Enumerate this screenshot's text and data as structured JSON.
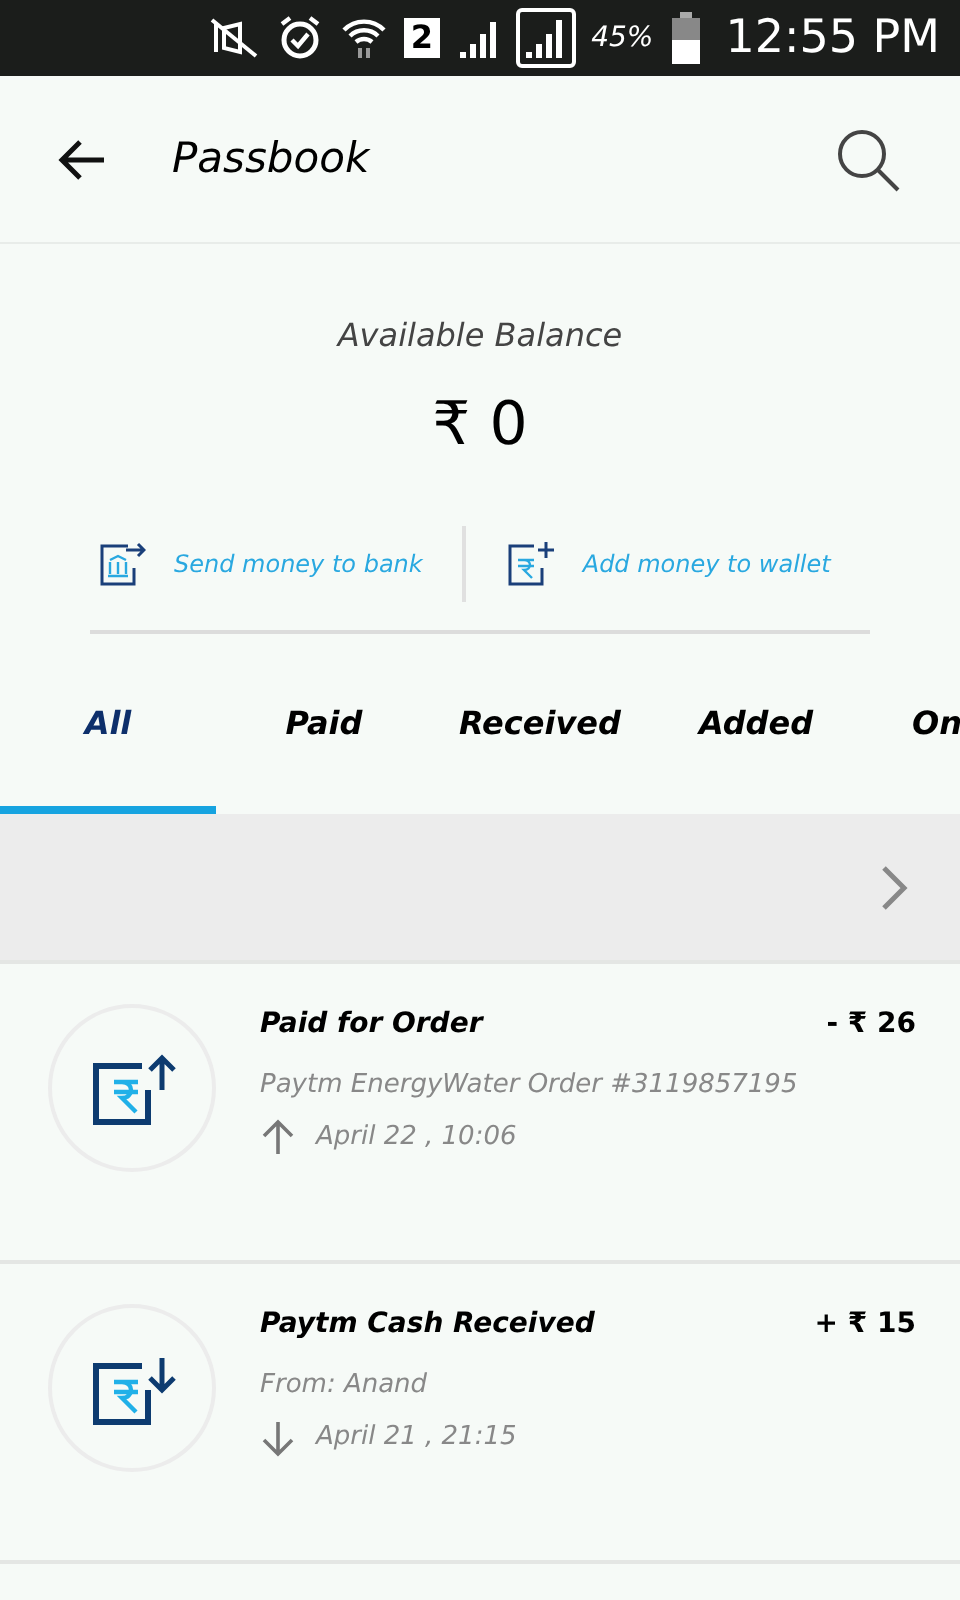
{
  "status_bar": {
    "sim": "2",
    "battery": "45%",
    "time": "12:55 PM"
  },
  "app_bar": {
    "title": "Passbook"
  },
  "balance": {
    "label": "Available Balance",
    "amount": "₹ 0"
  },
  "actions": [
    {
      "kind": "bank",
      "label": "Send money to bank"
    },
    {
      "kind": "wallet",
      "label": "Add money to wallet"
    }
  ],
  "tabs": [
    {
      "label": "All",
      "selected": true
    },
    {
      "label": "Paid",
      "selected": false
    },
    {
      "label": "Received",
      "selected": false
    },
    {
      "label": "Added",
      "selected": false
    },
    {
      "label": "On",
      "selected": false
    }
  ],
  "transactions": [
    {
      "kind": "paid",
      "title": "Paid for Order",
      "amount": "- ₹ 26",
      "detail": "Paytm EnergyWater Order #3119857195",
      "time": "April 22 , 10:06"
    },
    {
      "kind": "received",
      "title": "Paytm Cash Received",
      "amount": "+ ₹ 15",
      "detail": "From: Anand",
      "time": "April 21 , 21:15"
    }
  ]
}
